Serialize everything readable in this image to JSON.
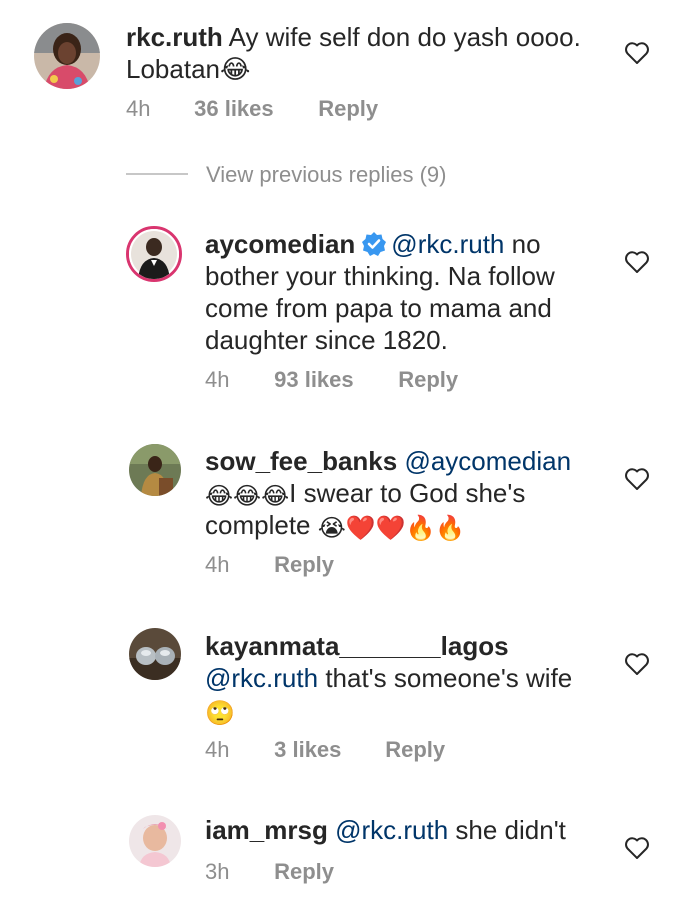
{
  "comments": [
    {
      "username": "rkc.ruth",
      "text": "Ay wife self don do yash oooo. Lobatan😂",
      "time": "4h",
      "likes": "36 likes",
      "reply": "Reply"
    },
    {
      "username": "aycomedian",
      "mention": "@rkc.ruth",
      "text": "no bother your thinking. Na follow come from papa to mama and daughter since 1820.",
      "time": "4h",
      "likes": "93 likes",
      "reply": "Reply"
    },
    {
      "username": "sow_fee_banks",
      "mention": "@aycomedian",
      "emojis_a": "😂😂😂",
      "text": "I swear to God she's complete",
      "emojis_b": "😭❤️❤️🔥🔥",
      "time": "4h",
      "reply": "Reply"
    },
    {
      "username": "kayanmata_______lagos",
      "mention": "@rkc.ruth",
      "text": "that's someone's wife",
      "emojis": "🙄",
      "time": "4h",
      "likes": "3 likes",
      "reply": "Reply"
    },
    {
      "username": "iam_mrsg",
      "mention": "@rkc.ruth",
      "text": "she didn't",
      "time": "3h",
      "reply": "Reply"
    }
  ],
  "view_previous": "View previous replies (9)",
  "colors": {
    "text": "#262626",
    "mention": "#003569",
    "meta": "#8e8e8e",
    "verified": "#3897f0"
  }
}
